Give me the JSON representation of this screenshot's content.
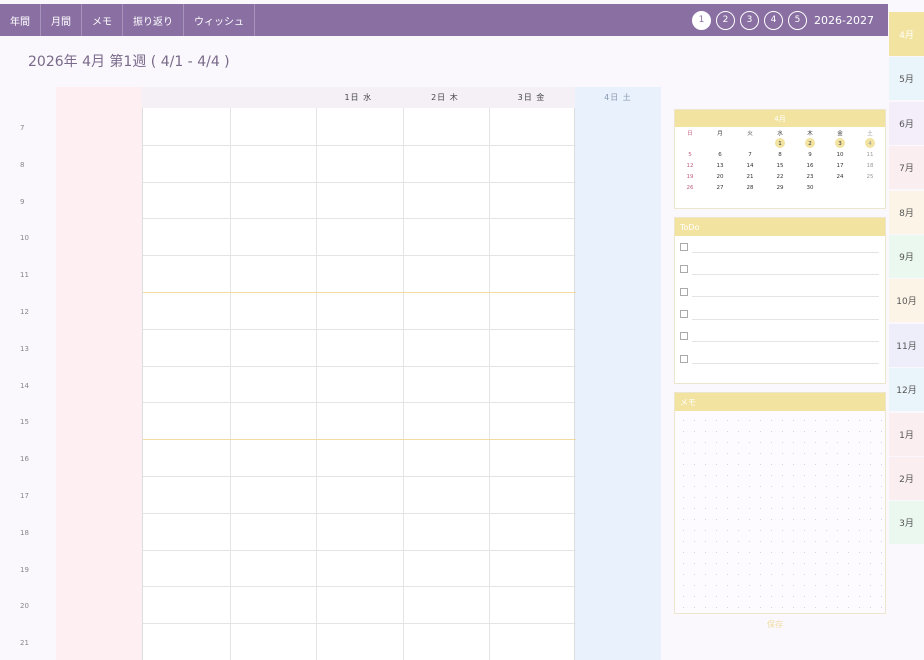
{
  "nav": {
    "items": [
      "年間",
      "月間",
      "メモ",
      "振り返り",
      "ウィッシュ"
    ],
    "weeks": [
      "1",
      "2",
      "3",
      "4",
      "5"
    ],
    "active_week": "1",
    "year_range": "2026-2027"
  },
  "title": "2026年 4月 第1週 ( 4/1 - 4/4 )",
  "schedule": {
    "day_headers": [
      "1日 水",
      "2日 木",
      "3日 金"
    ],
    "saturday_header": "4日 土",
    "hours": [
      "7",
      "8",
      "9",
      "10",
      "11",
      "12",
      "13",
      "14",
      "15",
      "16",
      "17",
      "18",
      "19",
      "20",
      "21"
    ]
  },
  "mini_calendar": {
    "title": "4月",
    "weekdays": [
      "日",
      "月",
      "火",
      "水",
      "木",
      "金",
      "土"
    ],
    "weeks": [
      [
        "",
        "",
        "",
        "1",
        "2",
        "3",
        "4"
      ],
      [
        "5",
        "6",
        "7",
        "8",
        "9",
        "10",
        "11"
      ],
      [
        "12",
        "13",
        "14",
        "15",
        "16",
        "17",
        "18"
      ],
      [
        "19",
        "20",
        "21",
        "22",
        "23",
        "24",
        "25"
      ],
      [
        "26",
        "27",
        "28",
        "29",
        "30",
        "",
        ""
      ]
    ],
    "highlighted_days": [
      "1",
      "2",
      "3",
      "4"
    ]
  },
  "todo": {
    "title": "ToDo",
    "item_count": 6
  },
  "memo": {
    "title": "メモ"
  },
  "save_label": "保存",
  "month_tabs": [
    {
      "label": "4月",
      "color": "#f3e3a0"
    },
    {
      "label": "5月",
      "color": "#eaf4fb"
    },
    {
      "label": "6月",
      "color": "#f4eefb"
    },
    {
      "label": "7月",
      "color": "#fbeef0"
    },
    {
      "label": "8月",
      "color": "#fcf4e6"
    },
    {
      "label": "9月",
      "color": "#eaf8ef"
    },
    {
      "label": "10月",
      "color": "#fcf4e6"
    },
    {
      "label": "11月",
      "color": "#eeeefb"
    },
    {
      "label": "12月",
      "color": "#eaf4fb"
    },
    {
      "label": "1月",
      "color": "#fbeef0"
    },
    {
      "label": "2月",
      "color": "#fbeef0"
    },
    {
      "label": "3月",
      "color": "#eaf8ef"
    }
  ],
  "colors": {
    "nav": "#8a6fa3",
    "accent": "#f3e3a0",
    "sunday_column": "#fdeff2",
    "saturday_column": "#e9f1fd"
  }
}
